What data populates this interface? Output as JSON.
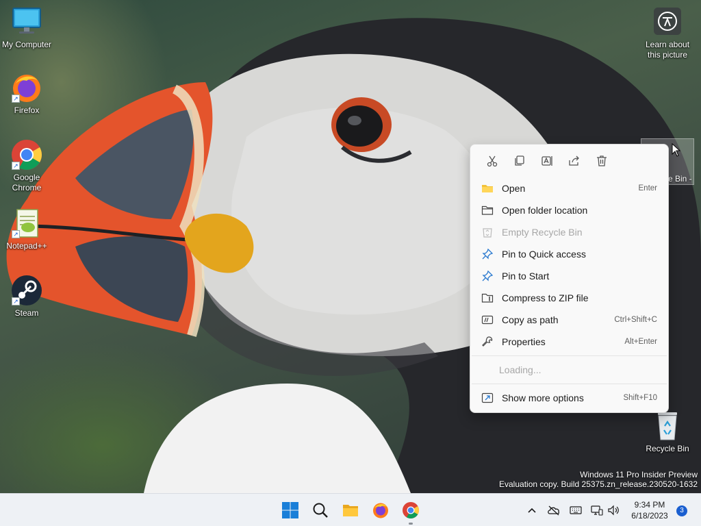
{
  "desktop": {
    "icons": [
      {
        "label": "My Computer",
        "icon": "monitor-icon"
      },
      {
        "label": "Firefox",
        "icon": "firefox-icon"
      },
      {
        "label": "Google Chrome",
        "icon": "chrome-icon"
      },
      {
        "label": "Notepad++",
        "icon": "notepadpp-icon"
      },
      {
        "label": "Steam",
        "icon": "steam-icon"
      }
    ],
    "learn_label": "Learn about this picture",
    "selected_label": "e Bin -",
    "recycle_bin_label": "Recycle Bin",
    "watermark": {
      "line1": "Windows 11 Pro Insider Preview",
      "line2": "Evaluation copy. Build 25375.zn_release.230520-1632"
    }
  },
  "context_menu": {
    "toolbar": [
      "cut-icon",
      "copy-icon",
      "rename-icon",
      "share-icon",
      "delete-icon"
    ],
    "items": [
      {
        "label": "Open",
        "shortcut": "Enter",
        "icon": "folder-open-icon",
        "disabled": false
      },
      {
        "label": "Open folder location",
        "shortcut": "",
        "icon": "folder-icon",
        "disabled": false
      },
      {
        "label": "Empty Recycle Bin",
        "shortcut": "",
        "icon": "recycle-bin-icon",
        "disabled": true
      },
      {
        "label": "Pin to Quick access",
        "shortcut": "",
        "icon": "pin-icon",
        "disabled": false
      },
      {
        "label": "Pin to Start",
        "shortcut": "",
        "icon": "pin-icon",
        "disabled": false
      },
      {
        "label": "Compress to ZIP file",
        "shortcut": "",
        "icon": "zip-icon",
        "disabled": false
      },
      {
        "label": "Copy as path",
        "shortcut": "Ctrl+Shift+C",
        "icon": "path-icon",
        "disabled": false
      },
      {
        "label": "Properties",
        "shortcut": "Alt+Enter",
        "icon": "wrench-icon",
        "disabled": false
      }
    ],
    "loading_text": "Loading...",
    "more_options": {
      "label": "Show more options",
      "shortcut": "Shift+F10",
      "icon": "more-options-icon"
    }
  },
  "taskbar": {
    "apps": [
      "windows-start-icon",
      "search-icon",
      "file-explorer-icon",
      "firefox-icon",
      "chrome-icon"
    ],
    "tray": [
      "chevron-up-icon",
      "onedrive-offline-icon",
      "keyboard-icon",
      "network-icon",
      "volume-icon"
    ],
    "time": "9:34 PM",
    "date": "6/18/2023",
    "notification_count": "3"
  },
  "colors": {
    "accent": "#1a5fd0",
    "menu_bg": "#f9f9f9",
    "taskbar_bg": "#eef1f5",
    "folder_yellow": "#f2c23a"
  }
}
